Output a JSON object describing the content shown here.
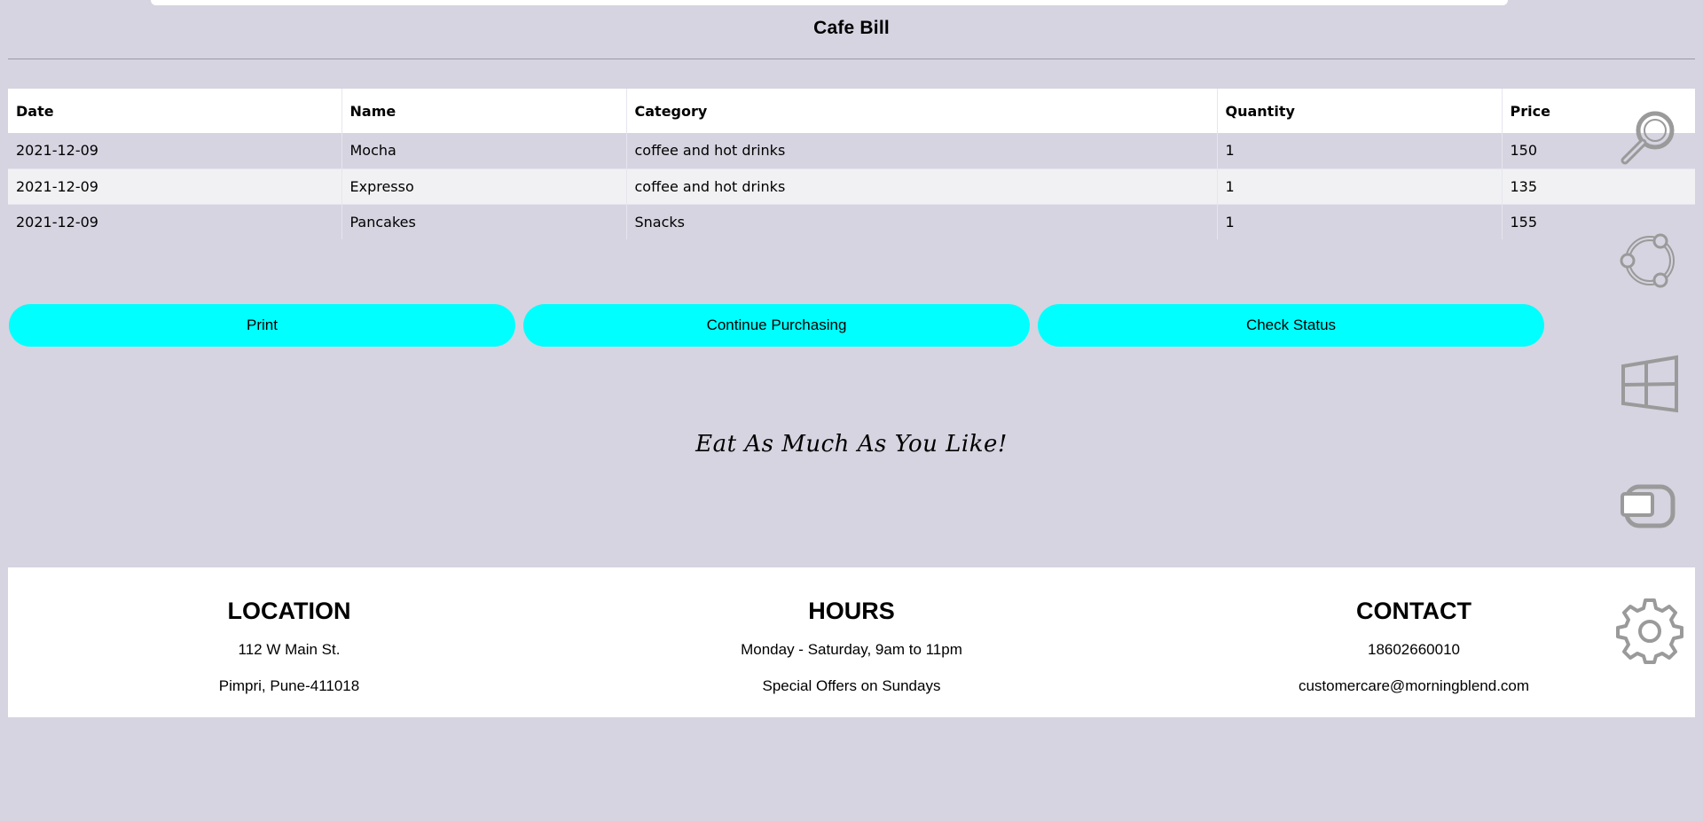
{
  "page": {
    "title": "Cafe Bill"
  },
  "bill_table": {
    "columns": [
      "Date",
      "Name",
      "Category",
      "Quantity",
      "Price"
    ],
    "rows": [
      [
        "2021-12-09",
        "Mocha",
        "coffee and hot drinks",
        "1",
        "150"
      ],
      [
        "2021-12-09",
        "Expresso",
        "coffee and hot drinks",
        "1",
        "135"
      ],
      [
        "2021-12-09",
        "Pancakes",
        "Snacks",
        "1",
        "155"
      ]
    ]
  },
  "actions": {
    "print_label": "Print",
    "continue_label": "Continue Purchasing",
    "status_label": "Check Status"
  },
  "tagline": "Eat As Much As You Like!",
  "footer": {
    "location": {
      "heading": "LOCATION",
      "line1": "112 W Main St.",
      "line2": "Pimpri, Pune-411018"
    },
    "hours": {
      "heading": "HOURS",
      "line1": "Monday - Saturday, 9am to 11pm",
      "line2": "Special Offers on Sundays"
    },
    "contact": {
      "heading": "CONTACT",
      "line1": "18602660010",
      "line2": "customercare@morningblend.com"
    }
  },
  "side_icons": [
    "search-icon",
    "ubuntu-icon",
    "windows-icon",
    "toggle-icon",
    "gear-icon"
  ],
  "colors": {
    "background": "#d6d4e0",
    "button": "#00ffff",
    "panel": "#ffffff",
    "icon": "#9a9a9a"
  }
}
